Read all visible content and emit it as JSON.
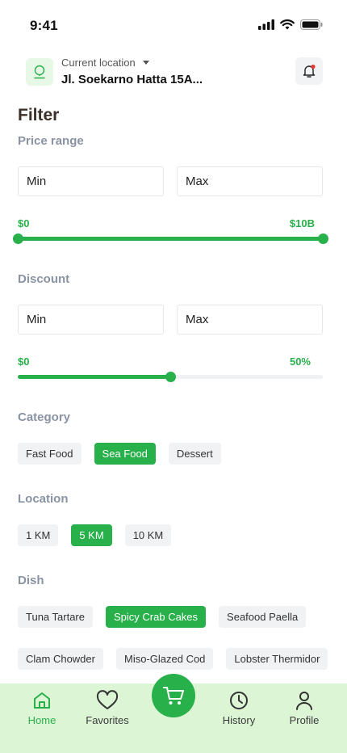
{
  "status": {
    "time": "9:41"
  },
  "location": {
    "label": "Current location",
    "value": "Jl. Soekarno Hatta 15A..."
  },
  "filter": {
    "title": "Filter"
  },
  "price": {
    "label": "Price range",
    "min_placeholder": "Min",
    "max_placeholder": "Max",
    "range_min_label": "$0",
    "range_max_label": "$10B",
    "slider_low": 0,
    "slider_high": 1
  },
  "discount": {
    "label": "Discount",
    "min_placeholder": "Min",
    "max_placeholder": "Max",
    "range_min_label": "$0",
    "range_max_label": "50%",
    "slider_value": 0.5
  },
  "category": {
    "label": "Category",
    "chips": [
      "Fast Food",
      "Sea Food",
      "Dessert"
    ],
    "selected": "Sea Food"
  },
  "location_filter": {
    "label": "Location",
    "chips": [
      "1 KM",
      "5 KM",
      "10 KM"
    ],
    "selected": "5 KM"
  },
  "dish": {
    "label": "Dish",
    "chips_row1": [
      "Tuna Tartare",
      "Spicy Crab Cakes",
      "Seafood Paella"
    ],
    "chips_row2": [
      "Clam Chowder",
      "Miso-Glazed Cod",
      "Lobster Thermidor"
    ],
    "selected": "Spicy Crab Cakes"
  },
  "nav": {
    "home": "Home",
    "favorites": "Favorites",
    "history": "History",
    "profile": "Profile",
    "active": "Home"
  },
  "colors": {
    "accent": "#28b04a",
    "nav_bg": "#dcf5d5",
    "chip_bg": "#f1f2f4",
    "notification_dot": "#e53935"
  }
}
